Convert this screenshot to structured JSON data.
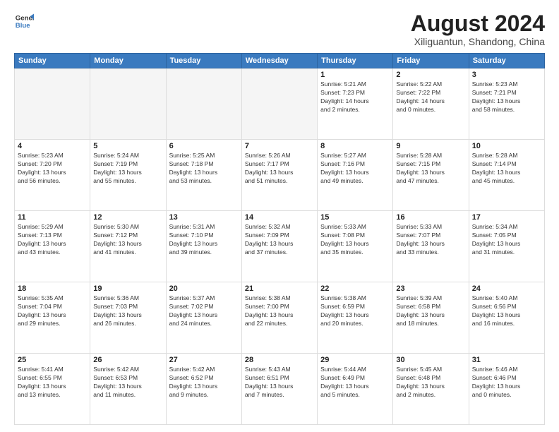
{
  "logo": {
    "line1": "General",
    "line2": "Blue"
  },
  "title": "August 2024",
  "subtitle": "Xiliguantun, Shandong, China",
  "weekdays": [
    "Sunday",
    "Monday",
    "Tuesday",
    "Wednesday",
    "Thursday",
    "Friday",
    "Saturday"
  ],
  "weeks": [
    [
      {
        "num": "",
        "info": ""
      },
      {
        "num": "",
        "info": ""
      },
      {
        "num": "",
        "info": ""
      },
      {
        "num": "",
        "info": ""
      },
      {
        "num": "1",
        "info": "Sunrise: 5:21 AM\nSunset: 7:23 PM\nDaylight: 14 hours\nand 2 minutes."
      },
      {
        "num": "2",
        "info": "Sunrise: 5:22 AM\nSunset: 7:22 PM\nDaylight: 14 hours\nand 0 minutes."
      },
      {
        "num": "3",
        "info": "Sunrise: 5:23 AM\nSunset: 7:21 PM\nDaylight: 13 hours\nand 58 minutes."
      }
    ],
    [
      {
        "num": "4",
        "info": "Sunrise: 5:23 AM\nSunset: 7:20 PM\nDaylight: 13 hours\nand 56 minutes."
      },
      {
        "num": "5",
        "info": "Sunrise: 5:24 AM\nSunset: 7:19 PM\nDaylight: 13 hours\nand 55 minutes."
      },
      {
        "num": "6",
        "info": "Sunrise: 5:25 AM\nSunset: 7:18 PM\nDaylight: 13 hours\nand 53 minutes."
      },
      {
        "num": "7",
        "info": "Sunrise: 5:26 AM\nSunset: 7:17 PM\nDaylight: 13 hours\nand 51 minutes."
      },
      {
        "num": "8",
        "info": "Sunrise: 5:27 AM\nSunset: 7:16 PM\nDaylight: 13 hours\nand 49 minutes."
      },
      {
        "num": "9",
        "info": "Sunrise: 5:28 AM\nSunset: 7:15 PM\nDaylight: 13 hours\nand 47 minutes."
      },
      {
        "num": "10",
        "info": "Sunrise: 5:28 AM\nSunset: 7:14 PM\nDaylight: 13 hours\nand 45 minutes."
      }
    ],
    [
      {
        "num": "11",
        "info": "Sunrise: 5:29 AM\nSunset: 7:13 PM\nDaylight: 13 hours\nand 43 minutes."
      },
      {
        "num": "12",
        "info": "Sunrise: 5:30 AM\nSunset: 7:12 PM\nDaylight: 13 hours\nand 41 minutes."
      },
      {
        "num": "13",
        "info": "Sunrise: 5:31 AM\nSunset: 7:10 PM\nDaylight: 13 hours\nand 39 minutes."
      },
      {
        "num": "14",
        "info": "Sunrise: 5:32 AM\nSunset: 7:09 PM\nDaylight: 13 hours\nand 37 minutes."
      },
      {
        "num": "15",
        "info": "Sunrise: 5:33 AM\nSunset: 7:08 PM\nDaylight: 13 hours\nand 35 minutes."
      },
      {
        "num": "16",
        "info": "Sunrise: 5:33 AM\nSunset: 7:07 PM\nDaylight: 13 hours\nand 33 minutes."
      },
      {
        "num": "17",
        "info": "Sunrise: 5:34 AM\nSunset: 7:05 PM\nDaylight: 13 hours\nand 31 minutes."
      }
    ],
    [
      {
        "num": "18",
        "info": "Sunrise: 5:35 AM\nSunset: 7:04 PM\nDaylight: 13 hours\nand 29 minutes."
      },
      {
        "num": "19",
        "info": "Sunrise: 5:36 AM\nSunset: 7:03 PM\nDaylight: 13 hours\nand 26 minutes."
      },
      {
        "num": "20",
        "info": "Sunrise: 5:37 AM\nSunset: 7:02 PM\nDaylight: 13 hours\nand 24 minutes."
      },
      {
        "num": "21",
        "info": "Sunrise: 5:38 AM\nSunset: 7:00 PM\nDaylight: 13 hours\nand 22 minutes."
      },
      {
        "num": "22",
        "info": "Sunrise: 5:38 AM\nSunset: 6:59 PM\nDaylight: 13 hours\nand 20 minutes."
      },
      {
        "num": "23",
        "info": "Sunrise: 5:39 AM\nSunset: 6:58 PM\nDaylight: 13 hours\nand 18 minutes."
      },
      {
        "num": "24",
        "info": "Sunrise: 5:40 AM\nSunset: 6:56 PM\nDaylight: 13 hours\nand 16 minutes."
      }
    ],
    [
      {
        "num": "25",
        "info": "Sunrise: 5:41 AM\nSunset: 6:55 PM\nDaylight: 13 hours\nand 13 minutes."
      },
      {
        "num": "26",
        "info": "Sunrise: 5:42 AM\nSunset: 6:53 PM\nDaylight: 13 hours\nand 11 minutes."
      },
      {
        "num": "27",
        "info": "Sunrise: 5:42 AM\nSunset: 6:52 PM\nDaylight: 13 hours\nand 9 minutes."
      },
      {
        "num": "28",
        "info": "Sunrise: 5:43 AM\nSunset: 6:51 PM\nDaylight: 13 hours\nand 7 minutes."
      },
      {
        "num": "29",
        "info": "Sunrise: 5:44 AM\nSunset: 6:49 PM\nDaylight: 13 hours\nand 5 minutes."
      },
      {
        "num": "30",
        "info": "Sunrise: 5:45 AM\nSunset: 6:48 PM\nDaylight: 13 hours\nand 2 minutes."
      },
      {
        "num": "31",
        "info": "Sunrise: 5:46 AM\nSunset: 6:46 PM\nDaylight: 13 hours\nand 0 minutes."
      }
    ]
  ]
}
